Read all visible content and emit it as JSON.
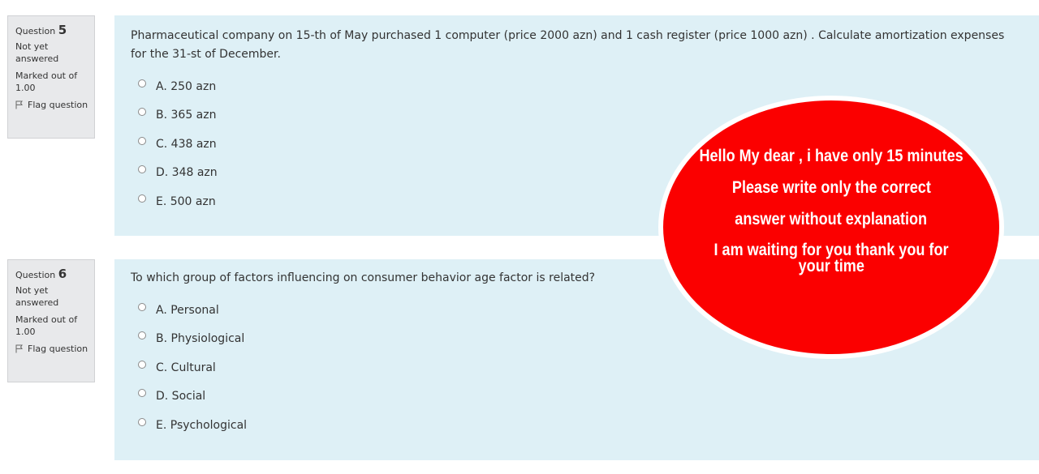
{
  "questions": [
    {
      "label": "Question",
      "number": "5",
      "state": "Not yet answered",
      "grade": "Marked out of 1.00",
      "flag_label": "Flag question",
      "text": "Pharmaceutical company on 15-th of May purchased 1 computer (price 2000 azn) and 1 cash register (price 1000 azn) . Calculate amortization expenses for the 31-st of December.",
      "options": [
        "A. 250 azn",
        "B. 365 azn",
        "C. 438 azn",
        "D. 348 azn",
        "E. 500 azn"
      ]
    },
    {
      "label": "Question",
      "number": "6",
      "state": "Not yet answered",
      "grade": "Marked out of 1.00",
      "flag_label": "Flag question",
      "text": "To which group of factors influencing on consumer behavior age factor is related?",
      "options": [
        "A. Personal",
        "B. Physiological",
        "C. Cultural",
        "D. Social",
        "E. Psychological"
      ]
    }
  ],
  "overlay": {
    "lines": [
      "Hello My dear , i have only 15 minutes",
      "Please write only the correct",
      "answer without explanation",
      "I am waiting for you thank you for",
      "your time"
    ],
    "color": "#fb0000"
  },
  "colors": {
    "content_bg": "#def0f6",
    "info_bg": "#e8e9eb"
  }
}
